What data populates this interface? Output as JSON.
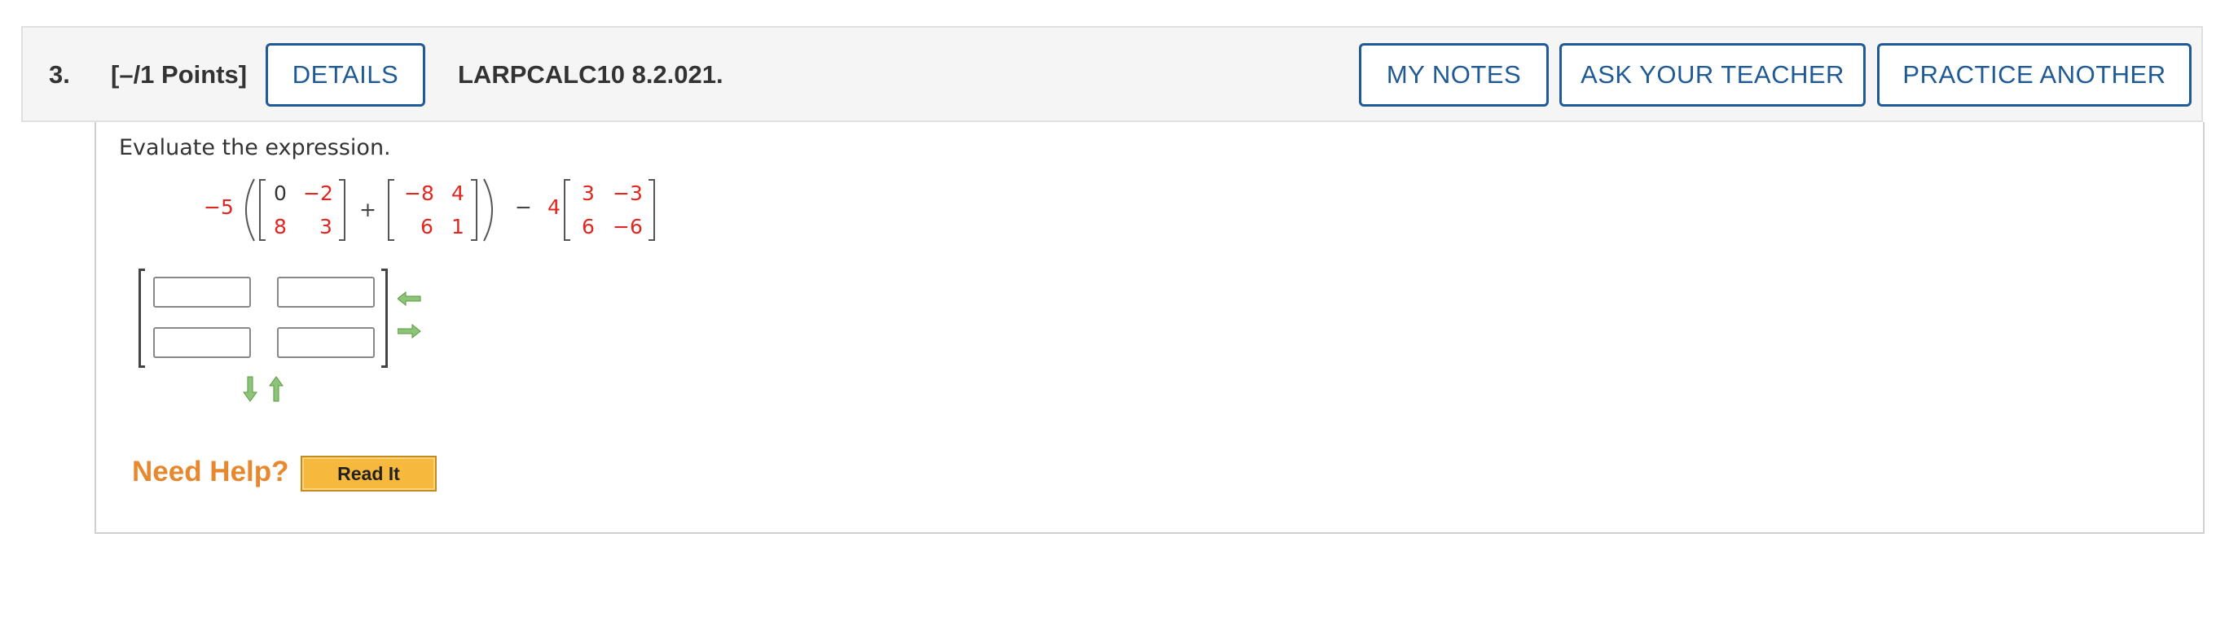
{
  "question": {
    "number": "3.",
    "points": "[–/1 Points]",
    "id": "LARPCALC10 8.2.021."
  },
  "buttons": {
    "details": "DETAILS",
    "my_notes": "MY NOTES",
    "ask_teacher": "ASK YOUR TEACHER",
    "practice_another": "PRACTICE ANOTHER"
  },
  "prompt": "Evaluate the expression.",
  "expression": {
    "coef1": "−5",
    "m1": [
      "0",
      "−2",
      "8",
      "3"
    ],
    "plus": "+",
    "m2": [
      "−8",
      "4",
      "6",
      "1"
    ],
    "minus": "−",
    "coef2": "4",
    "m3": [
      "3",
      "−3",
      "6",
      "−6"
    ]
  },
  "answer_matrix": {
    "rows": 2,
    "cols": 2,
    "values": [
      "",
      "",
      "",
      ""
    ]
  },
  "help": {
    "need_help": "Need Help?",
    "read_it": "Read It"
  },
  "colors": {
    "accent": "#1f5a96",
    "red": "#e0261f",
    "help_orange": "#e8882e",
    "arrow_green": "#5a9a3c"
  },
  "icons": [
    "arrow-left-icon",
    "arrow-right-icon",
    "arrow-down-icon",
    "arrow-up-icon"
  ]
}
